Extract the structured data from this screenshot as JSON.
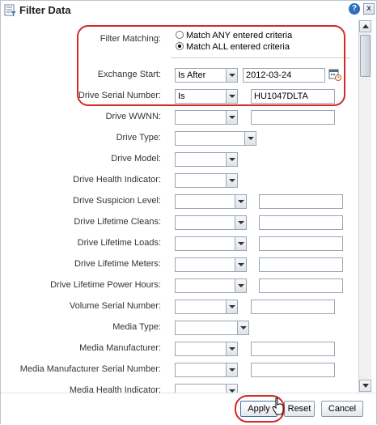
{
  "dialog": {
    "title": "Filter Data",
    "help_label": "?",
    "close_label": "x"
  },
  "filter_matching": {
    "label": "Filter Matching:",
    "options": [
      {
        "label": "Match ANY entered criteria",
        "selected": false
      },
      {
        "label": "Match ALL entered criteria",
        "selected": true
      }
    ]
  },
  "fields": {
    "exchange_start": {
      "label": "Exchange Start:",
      "operator": "Is After",
      "value": "2012-03-24"
    },
    "drive_serial_number": {
      "label": "Drive Serial Number:",
      "operator": "Is",
      "value": "HU1047DLTA"
    },
    "drive_wwnn": {
      "label": "Drive WWNN:",
      "operator": "",
      "value": ""
    },
    "drive_type": {
      "label": "Drive Type:",
      "operator": ""
    },
    "drive_model": {
      "label": "Drive Model:",
      "operator": ""
    },
    "drive_health_indicator": {
      "label": "Drive Health Indicator:",
      "operator": ""
    },
    "drive_suspicion_level": {
      "label": "Drive Suspicion Level:",
      "operator": "",
      "value": ""
    },
    "drive_lifetime_cleans": {
      "label": "Drive Lifetime Cleans:",
      "operator": "",
      "value": ""
    },
    "drive_lifetime_loads": {
      "label": "Drive Lifetime Loads:",
      "operator": "",
      "value": ""
    },
    "drive_lifetime_meters": {
      "label": "Drive Lifetime Meters:",
      "operator": "",
      "value": ""
    },
    "drive_lifetime_power_hours": {
      "label": "Drive Lifetime Power Hours:",
      "operator": "",
      "value": ""
    },
    "volume_serial_number": {
      "label": "Volume Serial Number:",
      "operator": "",
      "value": ""
    },
    "media_type": {
      "label": "Media Type:",
      "operator": ""
    },
    "media_manufacturer": {
      "label": "Media Manufacturer:",
      "operator": "",
      "value": ""
    },
    "media_manufacturer_serial_number": {
      "label": "Media Manufacturer Serial Number:",
      "operator": "",
      "value": ""
    },
    "media_health_indicator": {
      "label": "Media Health Indicator:",
      "operator": ""
    }
  },
  "buttons": {
    "apply": "Apply",
    "reset": "Reset",
    "cancel": "Cancel"
  },
  "icons": {
    "title": "filter-dialog-icon",
    "help": "help-icon",
    "close": "close-icon",
    "calendar": "calendar-icon"
  },
  "colors": {
    "highlight": "#d32a2a",
    "help_blue": "#2e6fc2"
  }
}
